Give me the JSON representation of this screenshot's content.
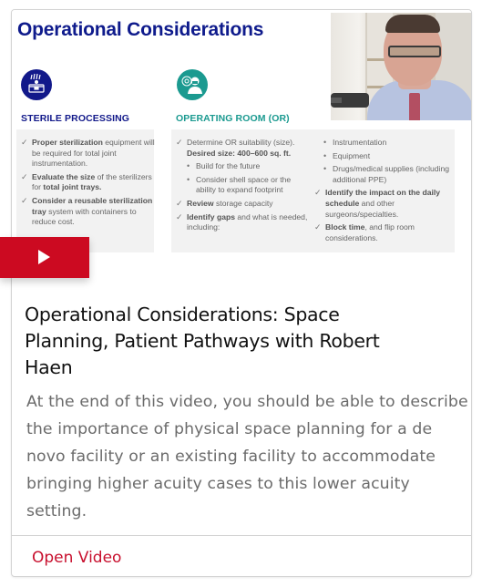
{
  "thumbnail": {
    "slide_title": "Operational Considerations",
    "icons": {
      "sterile": "sterilizer-icon",
      "or": "surgeon-icon"
    },
    "colors": {
      "navy": "#12198a",
      "teal": "#1b9a90",
      "play_red": "#cc0a21"
    },
    "sterile": {
      "heading": "STERILE PROCESSING",
      "items": [
        {
          "bold": "Proper sterilization",
          "text": " equipment will be required for total joint instrumentation."
        },
        {
          "bold": "Evaluate the size",
          "text": " of the sterilizers for ",
          "bold2": "total joint trays."
        },
        {
          "bold": "Consider a reusable sterilization tray",
          "text": " system with containers to reduce cost."
        }
      ]
    },
    "or": {
      "heading": "OPERATING ROOM (OR)",
      "col1": [
        {
          "type": "check",
          "text": "Determine OR suitability (size). ",
          "bold": "Desired size: 400–600 sq. ft."
        },
        {
          "type": "bullet",
          "text": "Build for the future"
        },
        {
          "type": "bullet",
          "text": "Consider shell space or the ability to expand footprint"
        },
        {
          "type": "check",
          "bold": "Review",
          "text": " storage capacity"
        },
        {
          "type": "check",
          "bold": "Identify gaps",
          "text": " and what is needed, including:"
        }
      ],
      "col2": [
        {
          "type": "bullet",
          "text": "Instrumentation"
        },
        {
          "type": "bullet",
          "text": "Equipment"
        },
        {
          "type": "bullet",
          "text": "Drugs/medical supplies (including additional PPE)"
        },
        {
          "type": "check",
          "bold": "Identify the impact on the daily schedule",
          "text": " and other surgeons/specialties."
        },
        {
          "type": "check",
          "bold": "Block time",
          "text": ", and flip room considerations."
        }
      ]
    },
    "play_icon": "play-icon"
  },
  "card": {
    "title": "Operational Considerations: Space Planning, Patient Pathways with Robert Haen",
    "description": "At the end of this video, you should be able to describe the importance of physical space planning for a de novo facility or an existing facility to accommodate bringing higher acuity cases to this lower acuity setting.",
    "action_label": "Open Video"
  }
}
